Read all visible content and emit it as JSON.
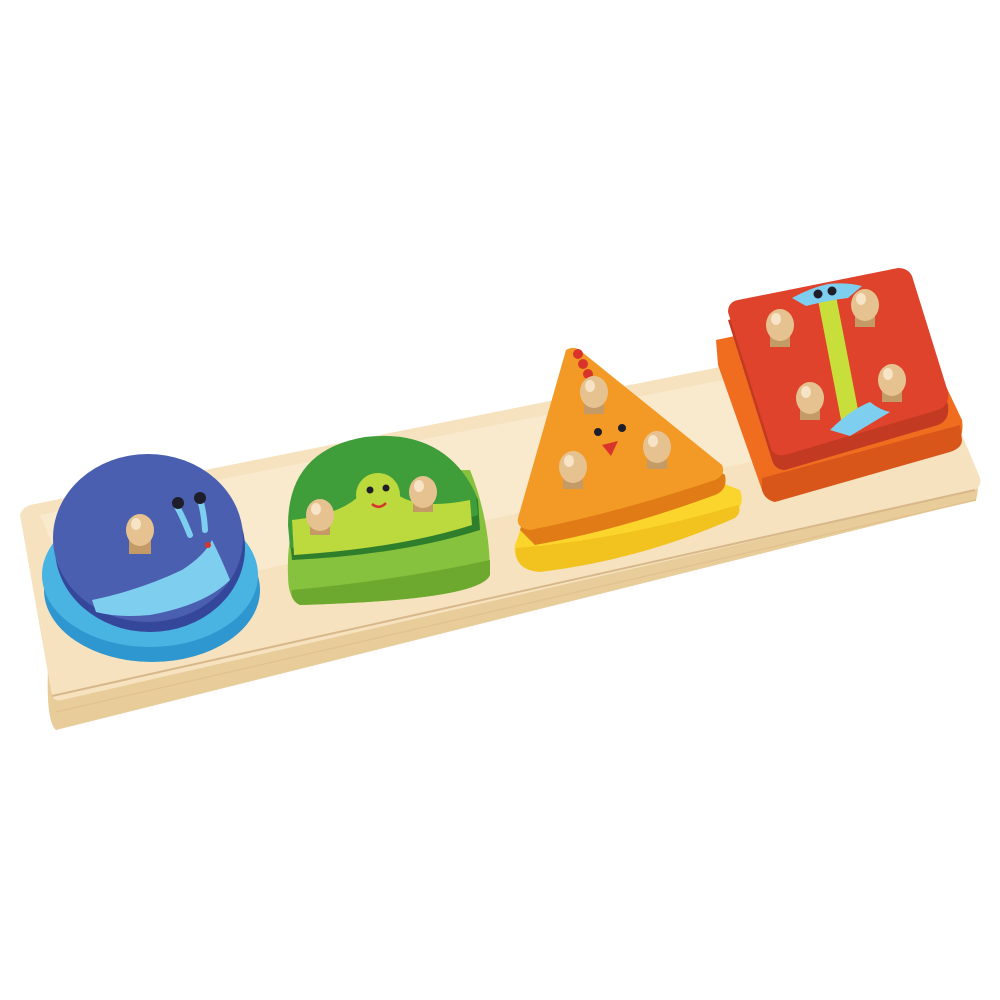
{
  "scene": {
    "subject": "wooden-shape-sorter-toy",
    "background_color": "#ffffff",
    "colors": {
      "wood_top": "#f6e2bf",
      "wood_top_light": "#fbefd8",
      "wood_front": "#ead0a0",
      "wood_edge": "#d8b88a",
      "peg": "#e7c291",
      "peg_highlight": "#f7e4c6",
      "circle_top": "#4a5fb0",
      "circle_base": "#49b3e2",
      "dome_top": "#3f9d3a",
      "dome_base": "#86c23d",
      "dome_band": "#bcd93d",
      "triangle_top": "#f39a26",
      "triangle_base": "#fbd52c",
      "square_top": "#e0432c",
      "square_base": "#f06c1f",
      "accent_blue": "#7ecfef",
      "accent_lime": "#c7de3b",
      "face_dark": "#1e1e2a",
      "mouth_red": "#d9342b"
    },
    "pieces": [
      {
        "shape": "circle",
        "animal": "snail",
        "pegs": 1
      },
      {
        "shape": "semicircle",
        "animal": "turtle",
        "pegs": 2
      },
      {
        "shape": "triangle",
        "animal": "chick",
        "pegs": 3
      },
      {
        "shape": "square",
        "animal": "butterfly",
        "pegs": 4
      }
    ]
  }
}
